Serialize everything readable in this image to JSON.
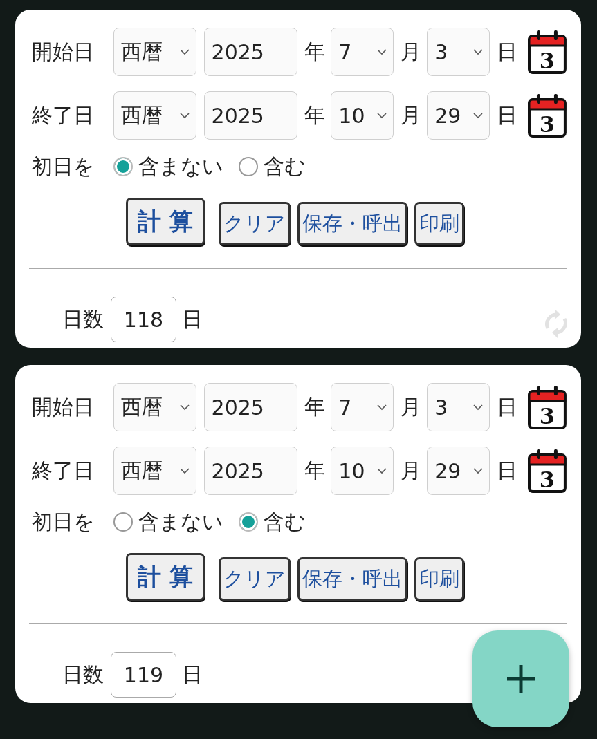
{
  "cards": [
    {
      "rows": [
        {
          "label": "開始日",
          "era": "西暦",
          "year": "2025",
          "year_unit": "年",
          "month": "7",
          "month_unit": "月",
          "day": "3",
          "day_unit": "日",
          "calendar": "3"
        },
        {
          "label": "終了日",
          "era": "西暦",
          "year": "2025",
          "year_unit": "年",
          "month": "10",
          "month_unit": "月",
          "day": "29",
          "day_unit": "日",
          "calendar": "3"
        }
      ],
      "first_day": {
        "label": "初日を",
        "options": [
          {
            "label": "含まない",
            "selected": true
          },
          {
            "label": "含む",
            "selected": false
          }
        ]
      },
      "buttons": [
        {
          "label": "計 算",
          "kind": "primary"
        },
        {
          "label": "クリア",
          "kind": "normal"
        },
        {
          "label": "保存・呼出",
          "kind": "normal"
        },
        {
          "label": "印刷",
          "kind": "normal"
        }
      ],
      "result": {
        "label": "日数",
        "value": "118",
        "unit": "日"
      },
      "refresh_icon": true
    },
    {
      "rows": [
        {
          "label": "開始日",
          "era": "西暦",
          "year": "2025",
          "year_unit": "年",
          "month": "7",
          "month_unit": "月",
          "day": "3",
          "day_unit": "日",
          "calendar": "3"
        },
        {
          "label": "終了日",
          "era": "西暦",
          "year": "2025",
          "year_unit": "年",
          "month": "10",
          "month_unit": "月",
          "day": "29",
          "day_unit": "日",
          "calendar": "3"
        }
      ],
      "first_day": {
        "label": "初日を",
        "options": [
          {
            "label": "含まない",
            "selected": false
          },
          {
            "label": "含む",
            "selected": true
          }
        ]
      },
      "buttons": [
        {
          "label": "計 算",
          "kind": "primary"
        },
        {
          "label": "クリア",
          "kind": "normal"
        },
        {
          "label": "保存・呼出",
          "kind": "normal"
        },
        {
          "label": "印刷",
          "kind": "normal"
        }
      ],
      "result": {
        "label": "日数",
        "value": "119",
        "unit": "日"
      },
      "refresh_icon": false
    }
  ]
}
